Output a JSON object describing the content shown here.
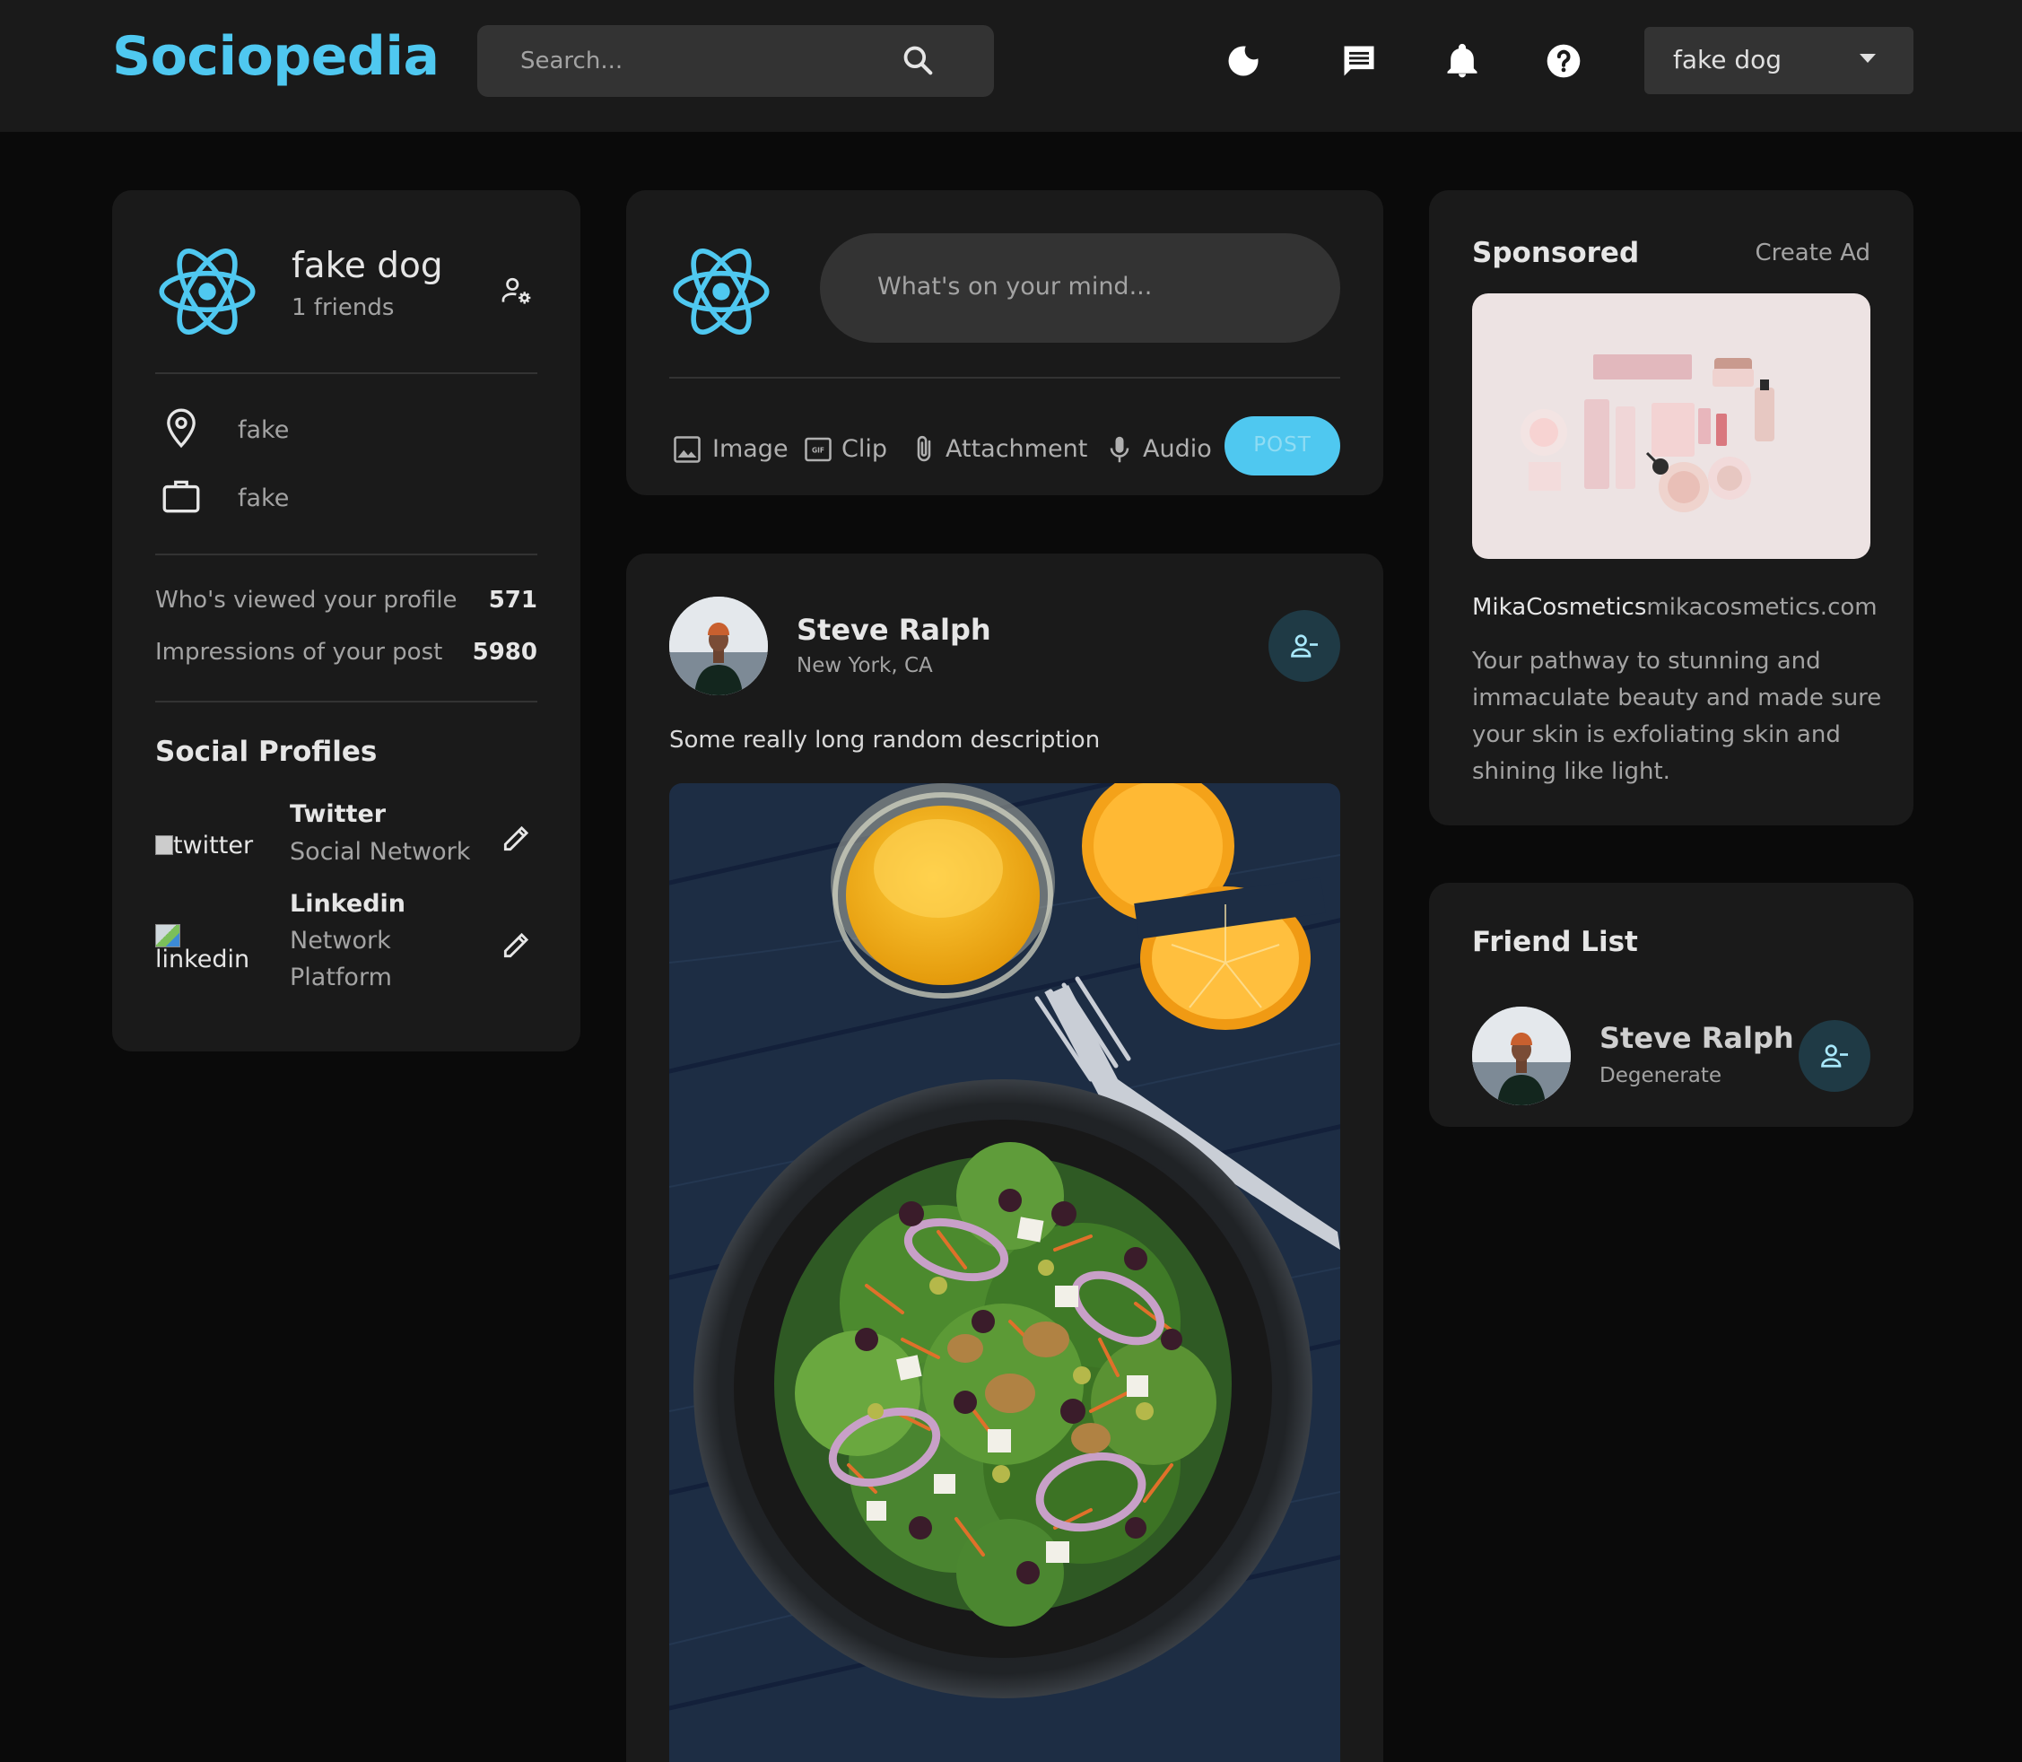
{
  "header": {
    "logo": "Sociopedia",
    "search_placeholder": "Search...",
    "user_name": "fake dog"
  },
  "icons": {
    "search": "search-icon",
    "dark_mode": "moon-icon",
    "messages": "message-icon",
    "notifications": "bell-icon",
    "help": "help-icon",
    "dropdown": "caret-down-icon"
  },
  "colors": {
    "accent": "#4fc8f0",
    "background": "#0a0a0a",
    "card": "#1a1a1a",
    "input": "#333333"
  },
  "profile": {
    "name": "fake dog",
    "friends": "1 friends",
    "location": "fake",
    "occupation": "fake",
    "viewed_label": "Who's viewed your profile",
    "viewed_value": "571",
    "impressions_label": "Impressions of your post",
    "impressions_value": "5980",
    "social_title": "Social Profiles",
    "socials": [
      {
        "alt": "twitter",
        "name": "Twitter",
        "type": "Social Network"
      },
      {
        "alt": "linkedin",
        "name": "Linkedin",
        "type_line1": "Network",
        "type_line2": "Platform"
      }
    ]
  },
  "composer": {
    "placeholder": "What's on your mind...",
    "image": "Image",
    "clip": "Clip",
    "attachment": "Attachment",
    "audio": "Audio",
    "post": "POST"
  },
  "post": {
    "author": "Steve Ralph",
    "location": "New York, CA",
    "description": "Some really long random description"
  },
  "sponsored": {
    "title": "Sponsored",
    "create_ad": "Create Ad",
    "brand": "MikaCosmetics",
    "url": "mikacosmetics.com",
    "text_lines": [
      "Your pathway to stunning and",
      "immaculate beauty and made sure",
      "your skin is exfoliating skin and",
      "shining like light."
    ]
  },
  "friends": {
    "title": "Friend List",
    "items": [
      {
        "name": "Steve Ralph",
        "subtitle": "Degenerate"
      }
    ]
  }
}
